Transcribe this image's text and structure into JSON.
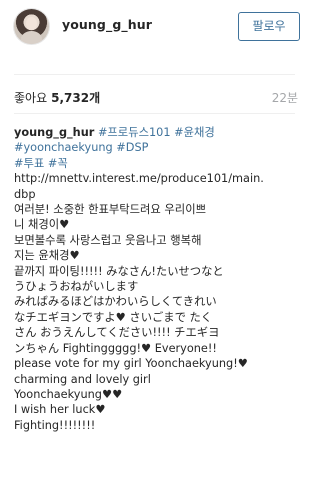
{
  "header": {
    "username": "young_g_hur",
    "follow_label": "팔로우",
    "avatar_icon": "profile-photo-icon"
  },
  "stats": {
    "likes_label": "좋아요",
    "likes_count": "5,732개",
    "time": "22분"
  },
  "caption": {
    "username": "young_g_hur",
    "tags_line1": [
      "#프로듀스101",
      "#윤채경"
    ],
    "tags_line2": [
      "#yoonchaekyung",
      "#DSP"
    ],
    "tags_line3": [
      "#투표",
      "#꼭"
    ],
    "lines": [
      "http://mnettv.interest.me/produce101/main.",
      "dbp",
      "여러분! 소중한 한표부탁드려요 우리이쁘",
      "니 채경이♥",
      "보면볼수록 사랑스럽고 웃음나고 행복해",
      "지는 윤채경♥",
      "끝까지 파이팅!!!!! みなさん!たいせつなと",
      "うひょうおねがいします",
      "みればみるほどはかわいらしくてきれい",
      "なチエギヨンですよ♥ さいごまで たく",
      "さん おうえんしてください!!!! チエギヨ",
      "ンちゃん Fightinggggg!♥ Everyone!!",
      "please vote for my girl Yoonchaekyung!♥",
      "charming and lovely girl",
      "Yoonchaekyung♥♥",
      "I wish her luck♥",
      "Fighting!!!!!!!!"
    ]
  },
  "colors": {
    "link": "#3f729b",
    "text": "#262626",
    "muted": "#a5a7aa",
    "divider": "#efefef"
  }
}
